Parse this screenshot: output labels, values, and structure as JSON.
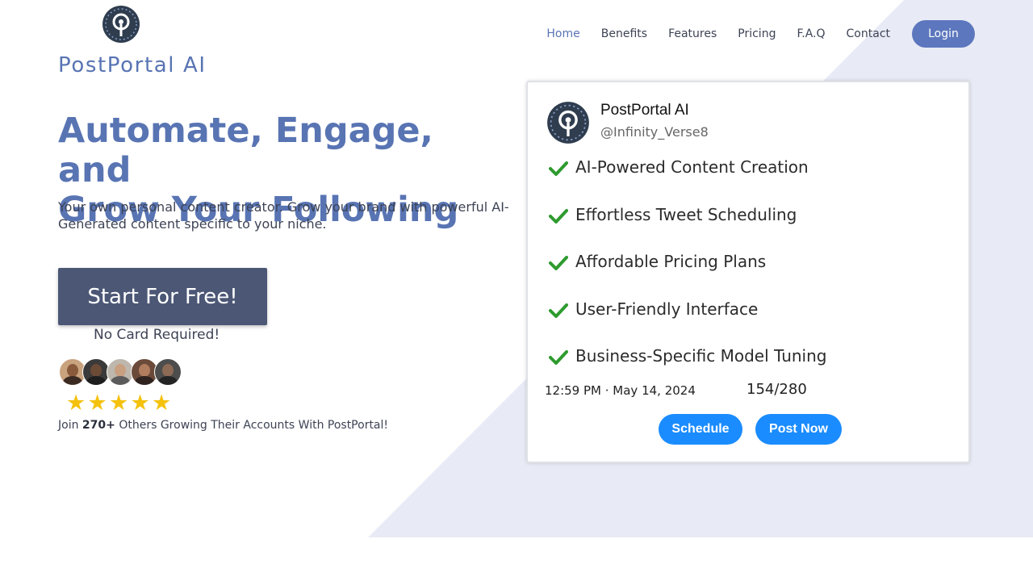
{
  "brand": {
    "name": "PostPortal AI",
    "logo_icon": "portal-logo-icon"
  },
  "nav": {
    "items": [
      {
        "label": "Home",
        "active": true
      },
      {
        "label": "Benefits"
      },
      {
        "label": "Features"
      },
      {
        "label": "Pricing"
      },
      {
        "label": "F.A.Q"
      },
      {
        "label": "Contact"
      }
    ],
    "login_label": "Login"
  },
  "hero": {
    "title_line1": "Automate, Engage, and",
    "title_line2": "Grow Your Following",
    "subtitle": "Your own personal content creator. Grow your brand with powerful AI-Generated content specific to your niche.",
    "cta_label": "Start For Free!",
    "cta_note": "No Card Required!",
    "rating_stars": 5,
    "social_proof_prefix": "Join ",
    "social_proof_count": "270+",
    "social_proof_suffix": " Others Growing Their Accounts With PostPortal!"
  },
  "tweet_card": {
    "name": "PostPortal AI",
    "handle": "@Infinity_Verse8",
    "features": [
      "AI-Powered Content Creation",
      "Effortless Tweet Scheduling",
      "Affordable Pricing Plans",
      "User-Friendly Interface",
      "Business-Specific Model Tuning"
    ],
    "timestamp": "12:59 PM · May 14, 2024",
    "char_count": "154/280",
    "schedule_label": "Schedule",
    "post_now_label": "Post Now"
  },
  "colors": {
    "brand_blue": "#5874b3",
    "login_bg": "#5c77bd",
    "cta_bg": "#4b5775",
    "tweet_button": "#1a8cff",
    "check_green": "#2e9b2e",
    "star": "#f4c20d",
    "background_shape": "#e8ebf5"
  }
}
